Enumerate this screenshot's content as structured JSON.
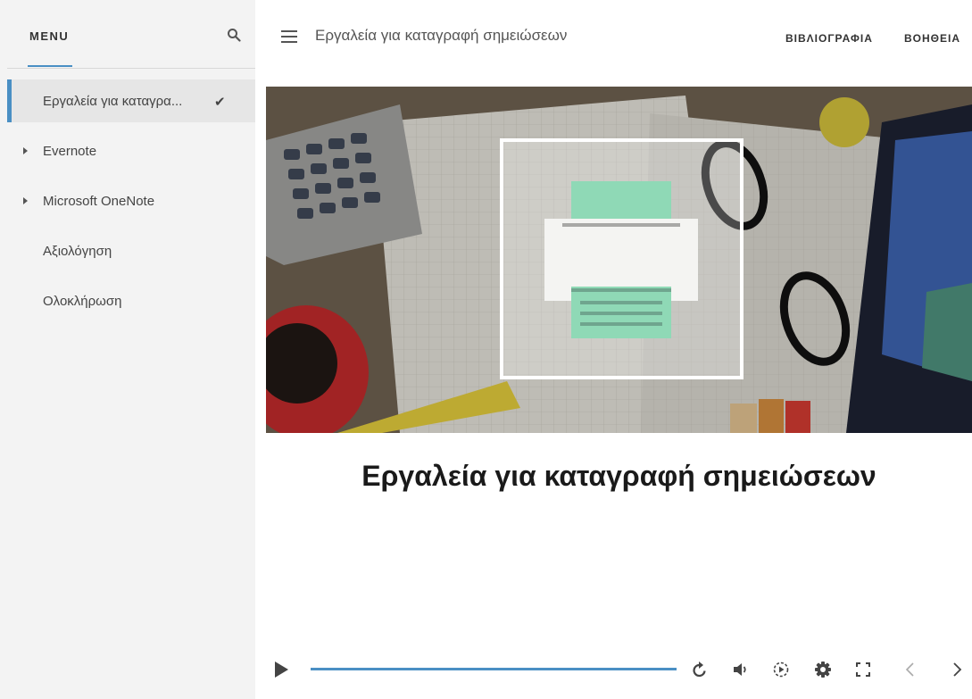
{
  "sidebar": {
    "menu_title": "MENU",
    "items": [
      {
        "label": "Εργαλεία για καταγρα...",
        "active": true,
        "completed": true,
        "expandable": false
      },
      {
        "label": "Evernote",
        "active": false,
        "completed": false,
        "expandable": true
      },
      {
        "label": "Microsoft OneNote",
        "active": false,
        "completed": false,
        "expandable": true
      },
      {
        "label": "Αξιολόγηση",
        "active": false,
        "completed": false,
        "expandable": false
      },
      {
        "label": "Ολοκλήρωση",
        "active": false,
        "completed": false,
        "expandable": false
      }
    ],
    "check_glyph": "✔"
  },
  "topbar": {
    "title": "Εργαλεία για καταγραφή σημειώσεων",
    "links": [
      "ΒΙΒΛΙΟΓΡΑΦΙΑ",
      "ΒΟΗΘΕΙΑ"
    ]
  },
  "content": {
    "heading": "Εργαλεία για καταγραφή σημειώσεων",
    "hero_icon": "printer-icon"
  },
  "player": {
    "progress": 1.0,
    "controls": [
      "play-icon",
      "replay-icon",
      "volume-icon",
      "speed-icon",
      "settings-icon",
      "fullscreen-icon",
      "prev-icon",
      "next-icon"
    ]
  },
  "colors": {
    "accent": "#4a8fc4",
    "sidebar_bg": "#f3f3f3",
    "active_item_bg": "#e6e6e6",
    "printer_paper": "#8fd9b6"
  }
}
